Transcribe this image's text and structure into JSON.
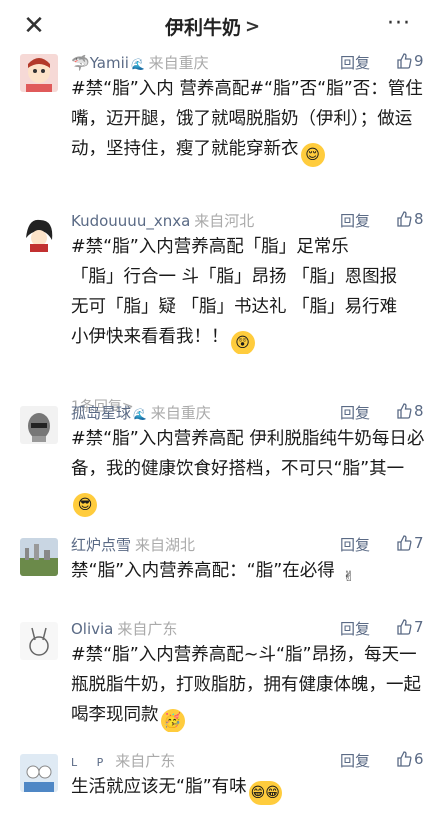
{
  "header": {
    "close": "✕",
    "title": "伊利牛奶",
    "chevron": ">",
    "more": "···"
  },
  "actions": {
    "reply_label": "回复"
  },
  "comments": [
    {
      "user": "Yamii",
      "location": "来自重庆",
      "like_count": "9",
      "text": "#禁“脂”入内 营养高配#“脂”否“脂”否：管住嘴，迈开腿，饿了就喝脱脂奶（伊利）；做运动，坚持住，瘦了就能穿新衣",
      "emoji": "😌"
    },
    {
      "user": "Kudouuuu_xnxa",
      "location": "来自河北",
      "like_count": "8",
      "text": "#禁“脂”入内营养高配「脂」足常乐\n「脂」行合一 斗「脂」昂扬 「脂」恩图报\n无可「脂」疑 「脂」书达礼 「脂」易行难\n小伊快来看看我！！",
      "emoji": "😲",
      "sub_reply": "1条回复>"
    },
    {
      "user": "孤岛星球",
      "location": "来自重庆",
      "like_count": "8",
      "text": "#禁“脂”入内营养高配 伊利脱脂纯牛奶每日必备，我的健康饮食好搭档，不可只“脂”其一",
      "emoji": "😎"
    },
    {
      "user": "红炉点雪",
      "location": "来自湖北",
      "like_count": "7",
      "text": "禁“脂”入内营养高配：“脂”在必得",
      "emoji": "✌"
    },
    {
      "user": "Olivia",
      "location": "来自广东",
      "like_count": "7",
      "text": "#禁“脂”入内营养高配~斗“脂”昂扬，每天一瓶脱脂牛奶，打败脂肪，拥有健康体魄，一起喝李现同款",
      "emoji": "🥳"
    },
    {
      "user": "L P",
      "location": "来自广东",
      "like_count": "6",
      "text": "生活就应该无“脂”有味",
      "emoji": "😁😁"
    }
  ],
  "colors": {
    "name": "#5a6a85",
    "location": "#aaaaaa",
    "text": "#1a1a1a",
    "icon": "#5a6a85"
  }
}
